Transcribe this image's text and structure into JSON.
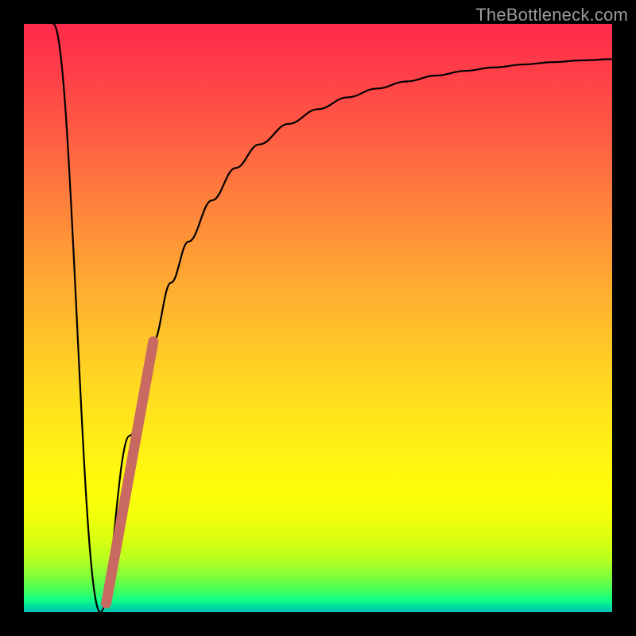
{
  "watermark": {
    "text": "TheBottleneck.com"
  },
  "colors": {
    "background": "#000000",
    "curve": "#000000",
    "marker": "#c86a62",
    "gradient_top": "#ff2a4b",
    "gradient_bottom": "#00c0b0"
  },
  "chart_data": {
    "type": "line",
    "title": "",
    "xlabel": "",
    "ylabel": "",
    "xlim": [
      0,
      100
    ],
    "ylim": [
      0,
      100
    ],
    "grid": false,
    "legend": false,
    "series": [
      {
        "name": "bottleneck-curve",
        "x": [
          5,
          13,
          18,
          22,
          25,
          28,
          32,
          36,
          40,
          45,
          50,
          55,
          60,
          65,
          70,
          75,
          80,
          85,
          90,
          95,
          100
        ],
        "values": [
          100,
          0,
          30,
          46,
          56,
          63,
          70,
          75.5,
          79.5,
          83,
          85.5,
          87.5,
          89,
          90.2,
          91.2,
          92,
          92.6,
          93.1,
          93.5,
          93.8,
          94
        ]
      }
    ],
    "annotations": [
      {
        "name": "highlight-segment",
        "type": "segment",
        "x": [
          14,
          22
        ],
        "values": [
          1.5,
          46
        ]
      }
    ]
  }
}
